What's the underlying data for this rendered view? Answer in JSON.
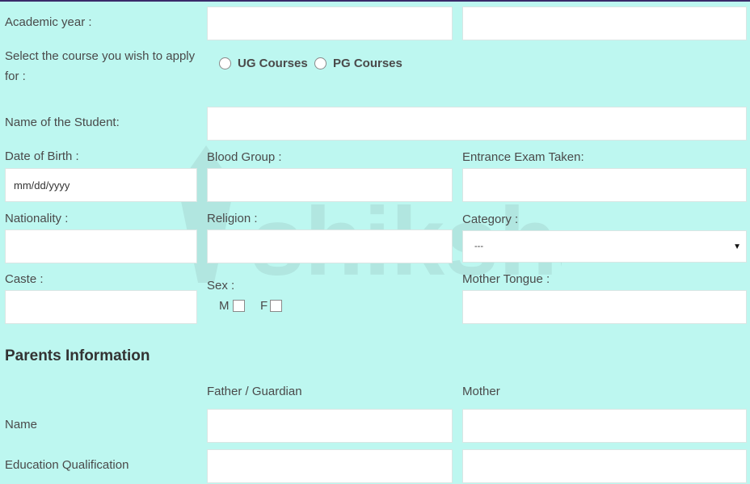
{
  "form": {
    "academic_year_label": "Academic year :",
    "academic_year_from": "",
    "academic_year_to": "",
    "course_label": "Select the course you wish to apply for :",
    "course_options": [
      "UG Courses",
      "PG Courses"
    ],
    "student_name_label": "Name of the Student:",
    "student_name_value": "",
    "dob_label": "Date of Birth :",
    "dob_placeholder": "mm/dd/yyyy",
    "blood_group_label": "Blood Group :",
    "blood_group_value": "",
    "entrance_exam_label": "Entrance Exam Taken:",
    "entrance_exam_value": "",
    "nationality_label": "Nationality :",
    "nationality_value": "",
    "religion_label": "Religion :",
    "religion_value": "",
    "category_label": "Category :",
    "category_selected": "---",
    "caste_label": "Caste :",
    "caste_value": "",
    "sex_label": "Sex :",
    "sex_options": [
      "M",
      "F"
    ],
    "mother_tongue_label": "Mother Tongue :",
    "mother_tongue_value": ""
  },
  "parents": {
    "section_title": "Parents Information",
    "col_father": "Father / Guardian",
    "col_mother": "Mother",
    "name_label": "Name",
    "education_label": "Education Qualification"
  },
  "watermark": {
    "text": "shiksha"
  },
  "colors": {
    "background": "#bdf7f0",
    "top_bar": "#3a2a6a",
    "field_bg": "#ffffff"
  }
}
